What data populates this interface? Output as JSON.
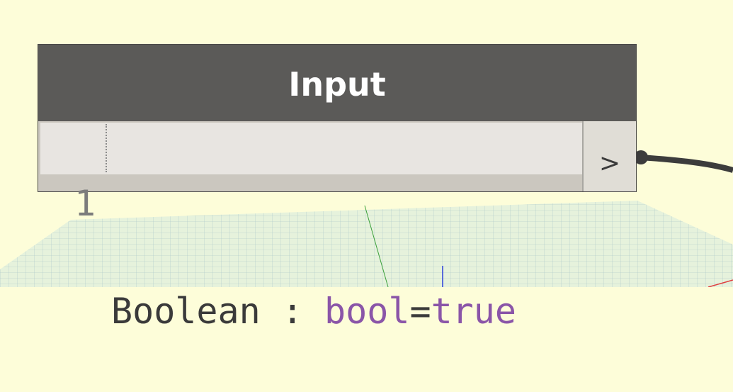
{
  "node": {
    "title": "Input",
    "line_number": "1",
    "code": {
      "name": "Boolean : ",
      "type": "bool",
      "eq": "=",
      "value": "true"
    },
    "output_port": ">"
  },
  "colors": {
    "background": "#fdfdd9",
    "header": "#5b5a58",
    "keyword": "#8a55a8"
  }
}
